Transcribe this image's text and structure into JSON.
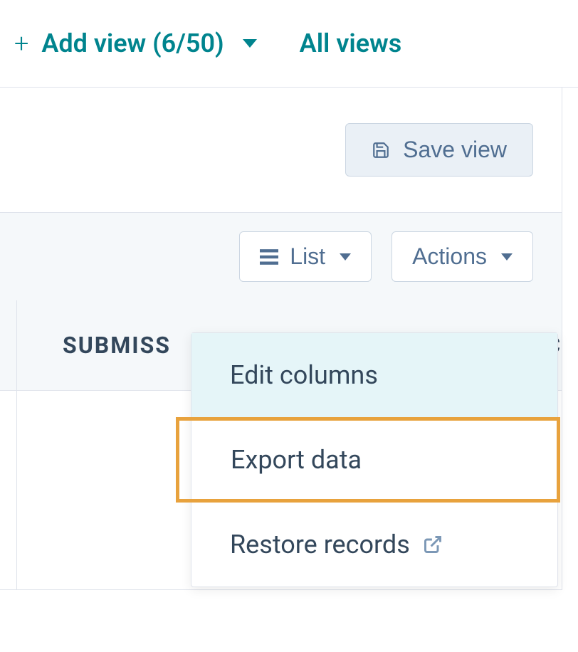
{
  "topBar": {
    "addView": {
      "label": "Add view (6/50)"
    },
    "allViews": {
      "label": "All views"
    }
  },
  "saveView": {
    "label": "Save view"
  },
  "toolbar": {
    "listButton": {
      "label": "List"
    },
    "actionsButton": {
      "label": "Actions"
    }
  },
  "table": {
    "columns": {
      "submiss": "SUBMISS",
      "partialC": "C"
    }
  },
  "dropdown": {
    "items": [
      {
        "label": "Edit columns"
      },
      {
        "label": "Export data"
      },
      {
        "label": "Restore records"
      }
    ]
  }
}
